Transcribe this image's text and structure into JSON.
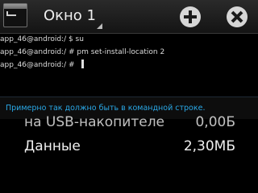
{
  "actionbar": {
    "window_title": "Окно 1",
    "app_icon": "terminal-icon",
    "add_icon": "plus-icon",
    "close_icon": "close-icon"
  },
  "terminal": {
    "lines": [
      "app_46@android:/ $ su",
      "app_46@android:/ # pm set-install-location 2",
      "app_46@android:/ #"
    ]
  },
  "hint": {
    "text": "Примерно так должно быть в командной строке."
  },
  "settings": {
    "rows": [
      {
        "label": "на USB-накопителе",
        "value": "0,00Б"
      },
      {
        "label": "Данные",
        "value": "2,30МБ"
      }
    ]
  },
  "colors": {
    "hint_text": "#2aa9e8",
    "actionbar_bg": "#1e1e1e",
    "button_bg": "#d6d6d6"
  }
}
